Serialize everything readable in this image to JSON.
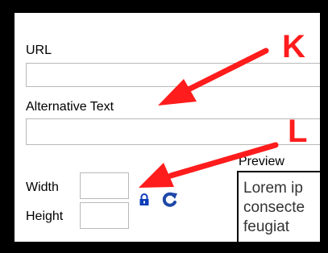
{
  "form": {
    "url_label": "URL",
    "url_value": "",
    "alt_label": "Alternative Text",
    "alt_value": "",
    "width_label": "Width",
    "width_value": "",
    "height_label": "Height",
    "height_value": "",
    "preview_label": "Preview",
    "preview_lines": [
      "Lorem ip",
      "consecte",
      "feugiat"
    ]
  },
  "icons": {
    "lock": "lock-icon",
    "refresh": "refresh-icon"
  },
  "annotations": {
    "k_label": "K",
    "l_label": "L",
    "color": "#ff1c1c"
  },
  "colors": {
    "lock_blue": "#0b3db8",
    "refresh_blue": "#1f49a8",
    "field_border": "#b9b9b9",
    "frame": "#000000"
  }
}
